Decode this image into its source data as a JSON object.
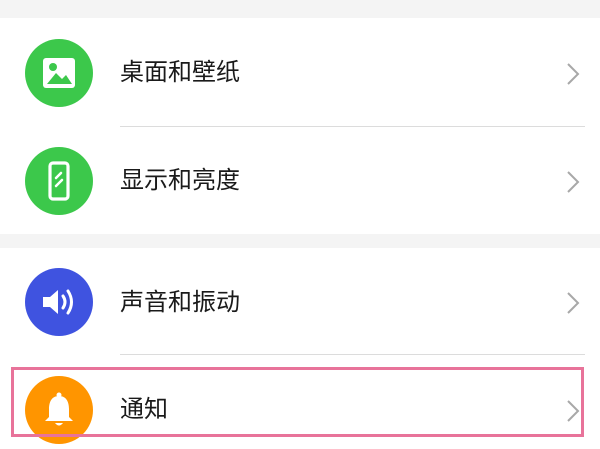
{
  "settings": {
    "items": [
      {
        "label": "桌面和壁纸",
        "icon": "image-icon",
        "color": "#3cc84b"
      },
      {
        "label": "显示和亮度",
        "icon": "phone-display-icon",
        "color": "#3cc84b"
      },
      {
        "label": "声音和振动",
        "icon": "speaker-icon",
        "color": "#3f53e0"
      },
      {
        "label": "通知",
        "icon": "bell-icon",
        "color": "#ff9500"
      }
    ]
  },
  "highlight": {
    "color": "#e8739a",
    "target": "通知"
  }
}
